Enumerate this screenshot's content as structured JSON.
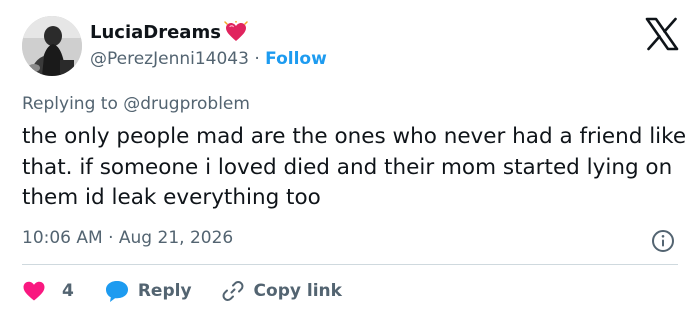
{
  "author": {
    "display_name": "LuciaDreams",
    "handle": "@PerezJenni14043",
    "separator": " · ",
    "follow_label": "Follow",
    "badge_icon": "heart-emoji-icon",
    "avatar": "avatar-photo"
  },
  "brand": {
    "logo_icon": "x-logo-icon"
  },
  "tweet": {
    "replying_to": "Replying to @drugproblem",
    "text": "the only people mad are the ones who never had a friend like that. if someone i loved died and their mom started lying on them id leak everything too",
    "timestamp": "10:06 AM · Aug 21, 2026"
  },
  "actions": {
    "like_count": "4",
    "reply_label": "Reply",
    "copy_link_label": "Copy link"
  },
  "colors": {
    "text": "#0f1419",
    "secondary": "#536471",
    "accent": "#1d9bf0",
    "like": "#f91880",
    "divider": "#cfd9de"
  }
}
